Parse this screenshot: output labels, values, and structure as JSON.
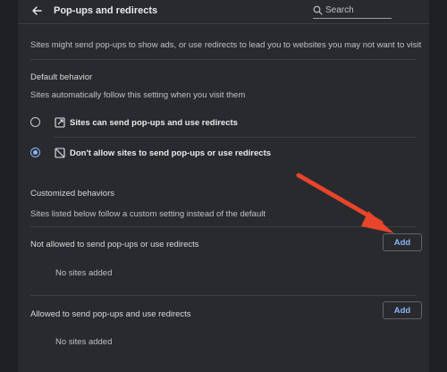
{
  "header": {
    "title": "Pop-ups and redirects",
    "search_placeholder": "Search"
  },
  "description": "Sites might send pop-ups to show ads, or use redirects to lead you to websites you may not want to visit",
  "default_behavior": {
    "heading": "Default behavior",
    "subtext": "Sites automatically follow this setting when you visit them",
    "options": [
      {
        "label": "Sites can send pop-ups and use redirects",
        "selected": false,
        "icon": "popup-open-icon"
      },
      {
        "label": "Don't allow sites to send pop-ups or use redirects",
        "selected": true,
        "icon": "popup-blocked-icon"
      }
    ]
  },
  "custom_behaviors": {
    "heading": "Customized behaviors",
    "subtext": "Sites listed below follow a custom setting instead of the default",
    "not_allowed": {
      "label": "Not allowed to send pop-ups or use redirects",
      "button": "Add",
      "empty": "No sites added"
    },
    "allowed": {
      "label": "Allowed to send pop-ups and use redirects",
      "button": "Add",
      "empty": "No sites added"
    }
  },
  "colors": {
    "accent": "#8ab4f8",
    "annotation_arrow": "#e8452c",
    "panel": "#292a2d",
    "background": "#1f2023"
  }
}
